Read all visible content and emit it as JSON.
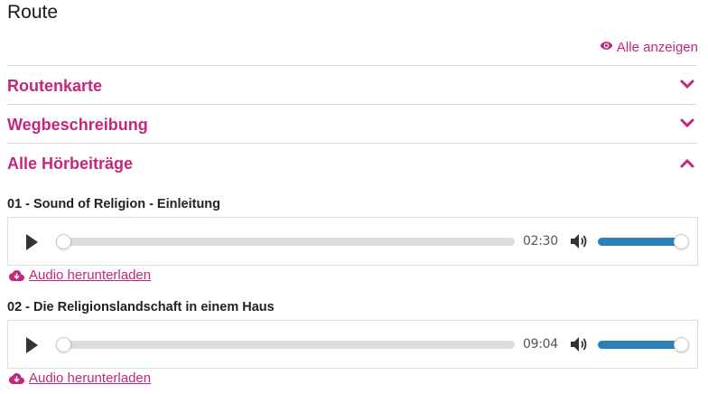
{
  "page": {
    "title": "Route"
  },
  "show_all": {
    "label": "Alle anzeigen",
    "icon": "eye-icon"
  },
  "accordion": [
    {
      "label": "Routenkarte",
      "expanded": false,
      "icon": "chevron-down-icon"
    },
    {
      "label": "Wegbeschreibung",
      "expanded": false,
      "icon": "chevron-down-icon"
    },
    {
      "label": "Alle Hörbeiträge",
      "expanded": true,
      "icon": "chevron-up-icon"
    }
  ],
  "tracks": [
    {
      "title": "01 - Sound of Religion - Einleitung",
      "duration": "02:30",
      "progress": 0.0,
      "volume": 1.0,
      "download_label": "Audio herunterladen"
    },
    {
      "title": "02 - Die Religionslandschaft in einem Haus",
      "duration": "09:04",
      "progress": 0.0,
      "volume": 1.0,
      "download_label": "Audio herunterladen"
    }
  ],
  "colors": {
    "accent": "#c4267f",
    "volume_fill": "#2d7fb8",
    "track_bg": "#dcdcdc",
    "divider": "#d9d9d9"
  }
}
